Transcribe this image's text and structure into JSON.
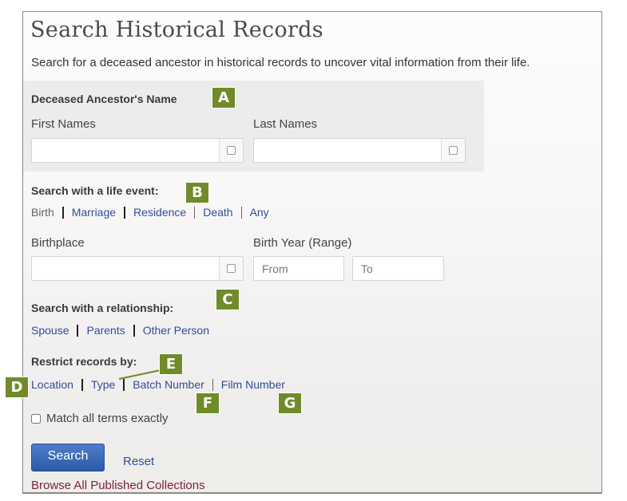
{
  "page": {
    "title": "Search Historical Records",
    "subtitle": "Search for a deceased ancestor in historical records to uncover vital information from their life."
  },
  "name_section": {
    "heading": "Deceased Ancestor's Name",
    "first_names": {
      "label": "First Names",
      "value": "",
      "placeholder": ""
    },
    "last_names": {
      "label": "Last Names",
      "value": "",
      "placeholder": ""
    }
  },
  "life_event": {
    "heading": "Search with a life event:",
    "options": [
      {
        "label": "Birth",
        "selected": true
      },
      {
        "label": "Marriage",
        "selected": false
      },
      {
        "label": "Residence",
        "selected": false
      },
      {
        "label": "Death",
        "selected": false
      },
      {
        "label": "Any",
        "selected": false
      }
    ],
    "birthplace": {
      "label": "Birthplace",
      "value": ""
    },
    "birth_year": {
      "label": "Birth Year (Range)",
      "from_placeholder": "From",
      "to_placeholder": "To"
    }
  },
  "relationship": {
    "heading": "Search with a relationship:",
    "options": [
      "Spouse",
      "Parents",
      "Other Person"
    ]
  },
  "restrict": {
    "heading": "Restrict records by:",
    "options": [
      "Location",
      "Type",
      "Batch Number",
      "Film Number"
    ]
  },
  "match_exact": {
    "label": "Match all terms exactly",
    "checked": false
  },
  "actions": {
    "search_label": "Search",
    "reset_label": "Reset",
    "browse_label": "Browse All Published Collections"
  },
  "callouts": {
    "a": "A",
    "b": "B",
    "c": "C",
    "d": "D",
    "e": "E",
    "f": "F",
    "g": "G",
    "color": "#6f8b2a"
  },
  "colors": {
    "link": "#2f4f99",
    "browse_link": "#7a2536",
    "search_button": "#2b5aa8"
  }
}
